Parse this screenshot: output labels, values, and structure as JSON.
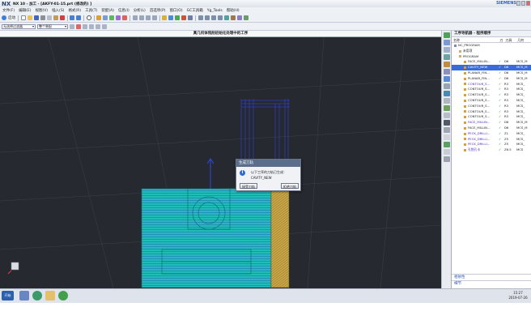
{
  "window": {
    "logo": "NX",
    "title": "NX 10 - 加工 - [AKFY-01-15.prt (修改的) ]",
    "brand": "SIEMENS"
  },
  "menubar": [
    "文件(F)",
    "编辑(E)",
    "视图(V)",
    "插入(S)",
    "格式(R)",
    "工具(T)",
    "装配(A)",
    "信息(I)",
    "分析(L)",
    "首选项(P)",
    "窗口(O)",
    "GC工具箱",
    "Yg_Tools",
    "帮助(H)"
  ],
  "toolbar1": {
    "start_label": "启动"
  },
  "toolbar2": {
    "filter_value": "无选择过滤器",
    "assembly_value": "整个装配"
  },
  "viewport": {
    "title": "真几何体铣削初始化处理中的工序"
  },
  "colors": {
    "part_face": "#20bcb8",
    "toolpath": "#3344ff",
    "accent": "#3a6cd8"
  },
  "navigator": {
    "title": "工序导航器 - 程序顺序",
    "columns": {
      "name": "名称",
      "toolchange": "刀",
      "tool": "刀具",
      "geometry": "几何"
    },
    "rows": [
      {
        "name": "NC_PROGRAM",
        "check": "",
        "tool": "",
        "geom": "",
        "style": "",
        "indent": 0
      },
      {
        "name": "未用项",
        "check": "",
        "tool": "",
        "geom": "",
        "style": "",
        "indent": 1
      },
      {
        "name": "PROGRAM",
        "check": "",
        "tool": "",
        "geom": "",
        "style": "",
        "indent": 1
      },
      {
        "name": "FACE_MILLIN...",
        "check": "✓",
        "tool": "D6",
        "geom": "MCS_M",
        "style": "",
        "indent": 2
      },
      {
        "name": "CAVITY_NEW",
        "check": "✓",
        "tool": "D6",
        "geom": "MCS_M",
        "style": "sel",
        "indent": 2
      },
      {
        "name": "PLANAR_FIN...",
        "check": "✓",
        "tool": "D6",
        "geom": "MCS_M",
        "style": "",
        "indent": 2
      },
      {
        "name": "PLANAR_FIN...",
        "check": "✓",
        "tool": "D6",
        "geom": "MCS_M",
        "style": "",
        "indent": 2
      },
      {
        "name": "CONTOUR_S...",
        "check": "✓",
        "tool": "R3",
        "geom": "MCS_",
        "style": "opn",
        "indent": 2
      },
      {
        "name": "CONTOUR_S...",
        "check": "✓",
        "tool": "R3",
        "geom": "MCS_",
        "style": "",
        "indent": 2
      },
      {
        "name": "CONTOUR_S...",
        "check": "✓",
        "tool": "R3",
        "geom": "MCS_",
        "style": "",
        "indent": 2
      },
      {
        "name": "CONTOUR_S...",
        "check": "✓",
        "tool": "R3",
        "geom": "MCS_",
        "style": "",
        "indent": 2
      },
      {
        "name": "CONTOUR_S...",
        "check": "✓",
        "tool": "R3",
        "geom": "MCS_",
        "style": "",
        "indent": 2
      },
      {
        "name": "CONTOUR_S...",
        "check": "✓",
        "tool": "R3",
        "geom": "MCS_",
        "style": "",
        "indent": 2
      },
      {
        "name": "CONTOUR_S...",
        "check": "✓",
        "tool": "R3",
        "geom": "MCS_",
        "style": "",
        "indent": 2
      },
      {
        "name": "FACE_MILLIN...",
        "check": "✓",
        "tool": "D6",
        "geom": "MCS_M",
        "style": "opn",
        "indent": 2
      },
      {
        "name": "FACE_MILLIN...",
        "check": "✓",
        "tool": "D6",
        "geom": "MCS_M",
        "style": "",
        "indent": 2
      },
      {
        "name": "PECK_DRILLI...",
        "check": "✓",
        "tool": "Z1",
        "geom": "MCS_",
        "style": "opn",
        "indent": 2
      },
      {
        "name": "PECK_DRILLI...",
        "check": "✓",
        "tool": "Z5",
        "geom": "MCS_",
        "style": "opn",
        "indent": 2
      },
      {
        "name": "PECK_DRILLI...",
        "check": "✓",
        "tool": "Z5",
        "geom": "MCS_",
        "style": "opn",
        "indent": 2
      },
      {
        "name": "孔铣孔卡",
        "check": "✓",
        "tool": "Z6.5",
        "geom": "MCS",
        "style": "opn",
        "indent": 2
      }
    ],
    "footer": [
      "相依性",
      "细节"
    ]
  },
  "dialog": {
    "title": "生成刀轨",
    "message": "以下工序的刀轨已生成：",
    "operation": "CAVITY_NEW",
    "accept_label": "接受刀轨",
    "reject_label": "拒绝刀轨"
  },
  "taskbar": {
    "start": "开始",
    "time": "15:27",
    "date": "2019-07-26"
  }
}
